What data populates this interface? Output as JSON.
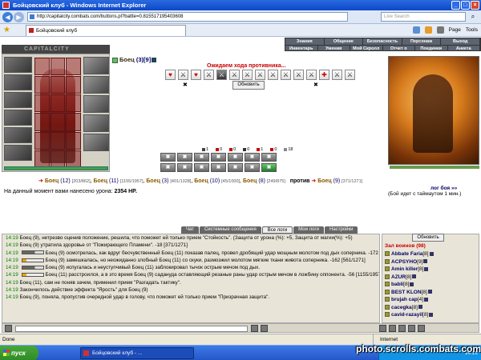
{
  "window": {
    "title": "Бойцовский клуб - Windows Internet Explorer",
    "min": "_",
    "max": "□",
    "close": "×"
  },
  "browser": {
    "url": "http://capitalcity.combats.com/buttons.pl?battle=0.815517195403608",
    "search_placeholder": "Live Search",
    "tab_title": "Бойцовский клуб",
    "tools": [
      "Page",
      "Tools"
    ]
  },
  "game_menu": {
    "row1": [
      "Знания",
      "Общение",
      "Безопасность",
      "Персонаж",
      "Выход"
    ],
    "row2": [
      "Инвентарь",
      "Умения",
      "Мой Скролл",
      "Отчет о переводах",
      "Поединки",
      "Анкета"
    ]
  },
  "logo": "CAPITALCITY",
  "player": {
    "name": "Боец",
    "level": "(3)",
    "id": "[9]"
  },
  "status_waiting": "Ожидаем хода противника...",
  "refresh_button": "Обновить",
  "attack_icons": [
    "♥",
    "⚔",
    "♥",
    "⚔",
    "⚔",
    "⚔",
    "⚔",
    "⚔",
    "⚔",
    "⚔",
    "⚔",
    "⚔",
    "✚",
    "⚔",
    "⚔"
  ],
  "stats": [
    {
      "val": "1",
      "color": "#444"
    },
    {
      "val": "0",
      "color": "#c00"
    },
    {
      "val": "0",
      "color": "#c00"
    },
    {
      "val": "0",
      "color": "#333"
    },
    {
      "val": "1",
      "color": "#c00"
    },
    {
      "val": "0",
      "color": "#c00"
    },
    {
      "val": "18",
      "color": "#888"
    }
  ],
  "team_left": [
    {
      "name": "Боец",
      "level": "(12)",
      "hp": "[203/862]"
    },
    {
      "name": "Боец",
      "level": "(11)",
      "hp": "[1155/1957]"
    },
    {
      "name": "Боец",
      "level": "(3)",
      "hp": "[401/1328]"
    },
    {
      "name": "Боец",
      "level": "(10)",
      "hp": "[45/1000]"
    },
    {
      "name": "Боец",
      "level": "(8)",
      "hp": "[249/875]"
    }
  ],
  "versus": "против",
  "team_right": [
    {
      "name": "Боец",
      "level": "(9)",
      "hp": "[371/1271]"
    }
  ],
  "battle_log_link": "лог боя »»",
  "damage": {
    "label": "На данный момент вами нанесено урона:",
    "value": "2354 HP."
  },
  "timeout": "(Бой идет с таймаутом 1 мин.)",
  "chat_tabs": [
    "Чат",
    "Системные сообщения",
    "Все логи",
    "Мои логи",
    "Настройки"
  ],
  "chat_lines": [
    {
      "time": "14:19",
      "text": "Боец (9), нетрезво оценив положение, решила, что поможет ей только прием \"Стойкость\". (Защита от урона (%): +5, Защита от магии(%): +5)"
    },
    {
      "time": "14:19",
      "text": "Боец (9) утратила здоровье от \"Пожирающего Пламени\". -18 [371/1271]"
    },
    {
      "time": "14:19",
      "text": "Боец (9) осмотрелась, как вдруг бесчувственный Боец (11) показав палец, провел дробящий удар мощным молотом под дых соперника. -172 [389/1271]"
    },
    {
      "time": "14:19",
      "text": "Боец (9) замешкалась, но неожиданно злобный Боец (11) со скуки, размозжил молотом мягкие ткани живота соперника. -162 [561/1271]"
    },
    {
      "time": "14:19",
      "text": "Боец (9) испугалась и неуступчивый Боец (11) заблокировал тычок острым мечом под дых."
    },
    {
      "time": "14:19",
      "text": "Боец (11) расстроился, а в это время Боец (9) садануда оставляющий резаные раны удар острым мечом в ложбину оппонента. -56 [1155/1957]"
    },
    {
      "time": "14:19",
      "text": "Боец (11), сам не поняв зачем, применил прием \"Разгадать тактику\"."
    },
    {
      "time": "14:19",
      "text": "Закончилось действие эффекта \"Ярость\" для Боец (9)"
    },
    {
      "time": "14:19",
      "text": "Боец (9), поняла, пропустив очередной удар в голову, что поможет ей только прием \"Призрачная защита\"."
    }
  ],
  "right_panel": {
    "refresh": "Обновить",
    "hall_title": "Зал воинов (98)",
    "fighters": [
      {
        "name": "Abbate Faria",
        "lv": "[8]"
      },
      {
        "name": "ACPSYHO",
        "lv": "[9]"
      },
      {
        "name": "Amin killer",
        "lv": "[8]"
      },
      {
        "name": "AZUR",
        "lv": "[8]"
      },
      {
        "name": "babli",
        "lv": "[8]"
      },
      {
        "name": "BEST KLON",
        "lv": "[8]"
      },
      {
        "name": "brujah cap",
        "lv": "[4]"
      },
      {
        "name": "cacegka",
        "lv": "[8]"
      },
      {
        "name": "cavid-razayil",
        "lv": "[8]"
      }
    ]
  },
  "statusbar": {
    "left": "Done",
    "zone": "Internet"
  },
  "taskbar": {
    "start": "пуск",
    "item": "Бойцовский клуб - ...",
    "clock": "14:19"
  },
  "watermark": "photo.scrolls.combats.com"
}
